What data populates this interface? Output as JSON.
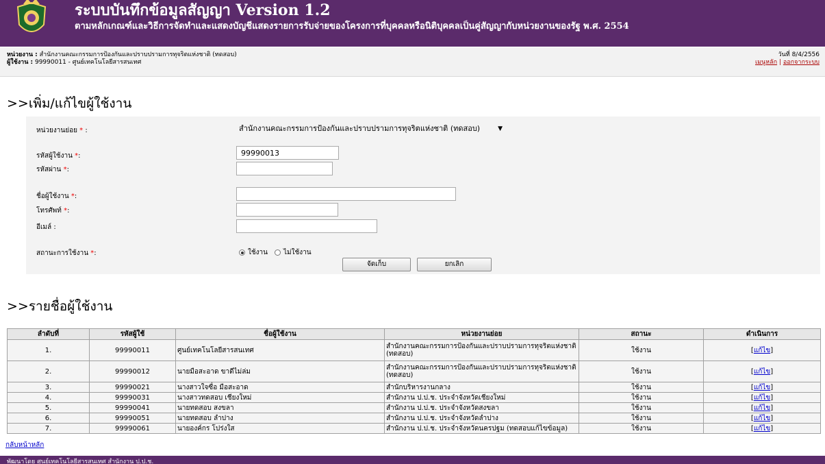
{
  "header": {
    "title": "ระบบบันทึกข้อมูลสัญญา Version 1.2",
    "subtitle": "ตามหลักเกณฑ์และวิธีการจัดทำและแสดงบัญชีแสดงรายการรับจ่ายของโครงการที่บุคคลหรือนิติบุคคลเป็นคู่สัญญากับหน่วยงานของรัฐ พ.ศ. 2554",
    "logo_icon": "seal-logo-icon"
  },
  "info": {
    "agency_label": "หน่วยงาน :",
    "agency_value": "สำนักงานคณะกรรมการป้องกันและปราบปรามการทุจริตแห่งชาติ (ทดสอบ)",
    "user_label": "ผู้ใช้งาน :",
    "user_value": "99990011 - ศูนย์เทคโนโลยีสารสนเทศ",
    "date": "วันที่ 8/4/2556",
    "menu_link": "เมนูหลัก",
    "logout_link": "ออกจากระบบ"
  },
  "form": {
    "title": ">>เพิ่ม/แก้ไขผู้ใช้งาน",
    "subunit_label": "หน่วยงานย่อย",
    "subunit_value": "สำนักงานคณะกรรมการป้องกันและปราบปรามการทุจริตแห่งชาติ (ทดสอบ)",
    "userid_label": "รหัสผู้ใช้งาน",
    "userid_value": "99990013",
    "password_label": "รหัสผ่าน",
    "username_label": "ชื่อผู้ใช้งาน",
    "phone_label": "โทรศัพท์",
    "email_label": "อีเมล์ :",
    "status_label": "สถานะการใช้งาน",
    "required_mark": "*",
    "colon": ":",
    "status_active": "ใช้งาน",
    "status_inactive": "ไม่ใช้งาน",
    "save_button": "จัดเก็บ",
    "cancel_button": "ยกเลิก"
  },
  "list": {
    "title": ">>รายชื่อผู้ใช้งาน",
    "columns": [
      "ลำดับที่",
      "รหัสผู้ใช้",
      "ชื่อผู้ใช้งาน",
      "หน่วยงานย่อย",
      "สถานะ",
      "ดำเนินการ"
    ],
    "edit_label": "แก้ไข",
    "rows": [
      {
        "no": "1.",
        "id": "99990011",
        "name": "ศูนย์เทคโนโลยีสารสนเทศ",
        "unit": "สำนักงานคณะกรรมการป้องกันและปราบปรามการทุจริตแห่งชาติ (ทดสอบ)",
        "status": "ใช้งาน"
      },
      {
        "no": "2.",
        "id": "99990012",
        "name": "นายมือสะอาด ขาดีไม่ล่ม",
        "unit": "สำนักงานคณะกรรมการป้องกันและปราบปรามการทุจริตแห่งชาติ (ทดสอบ)",
        "status": "ใช้งาน"
      },
      {
        "no": "3.",
        "id": "99990021",
        "name": "นางสาวใจซื่อ มือสะอาด",
        "unit": "สำนักบริหารงานกลาง",
        "status": "ใช้งาน"
      },
      {
        "no": "4.",
        "id": "99990031",
        "name": "นางสาวทดสอบ เชียงใหม่",
        "unit": "สำนักงาน ป.ป.ช. ประจำจังหวัดเชียงใหม่",
        "status": "ใช้งาน"
      },
      {
        "no": "5.",
        "id": "99990041",
        "name": "นายทดสอบ สงขลา",
        "unit": "สำนักงาน ป.ป.ช. ประจำจังหวัดสงขลา",
        "status": "ใช้งาน"
      },
      {
        "no": "6.",
        "id": "99990051",
        "name": "นายทดสอบ ลำปาง",
        "unit": "สำนักงาน ป.ป.ช. ประจำจังหวัดลำปาง",
        "status": "ใช้งาน"
      },
      {
        "no": "7.",
        "id": "99990061",
        "name": "นายองค์กร โปร่งใส",
        "unit": "สำนักงาน ป.ป.ช. ประจำจังหวัดนครปฐม (ทดสอบแก้ไขข้อมูล)",
        "status": "ใช้งาน"
      }
    ]
  },
  "back_link": "กลับหน้าหลัก",
  "footer": "พัฒนาโดย ศูนย์เทคโนโลยีสารสนเทศ สำนักงาน ป.ป.ช.",
  "colors": {
    "header_bg": "#5b2b6b",
    "link": "#0000cc",
    "required": "#ee0000"
  }
}
